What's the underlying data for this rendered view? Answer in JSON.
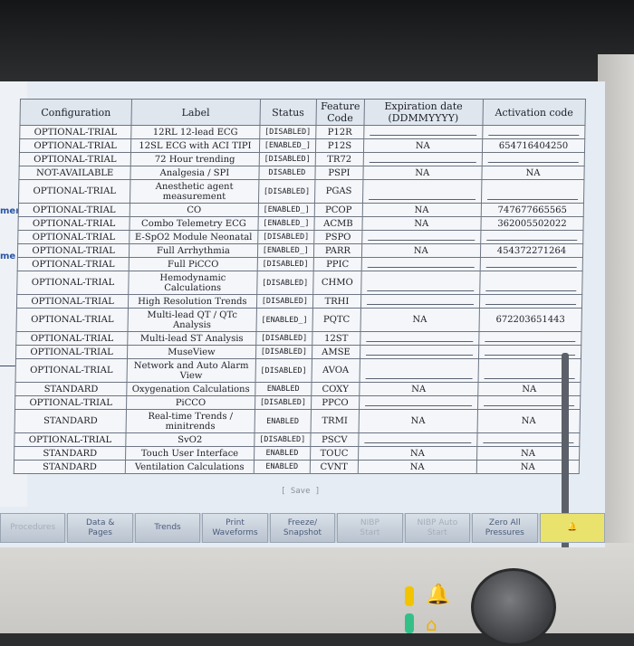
{
  "left_panel": {
    "frag1": "ment",
    "frag2": "me"
  },
  "table": {
    "headers": {
      "configuration": "Configuration",
      "label": "Label",
      "status": "Status",
      "feature_code": "Feature Code",
      "expiration_date": "Expiration date (DDMMYYYY)",
      "activation_code": "Activation code"
    },
    "rows": [
      {
        "config": "OPTIONAL-TRIAL",
        "label": "12RL 12-lead ECG",
        "status": "[DISABLED]",
        "code": "P12R",
        "exp": "",
        "act": ""
      },
      {
        "config": "OPTIONAL-TRIAL",
        "label": "12SL ECG with ACI TIPI",
        "status": "[ENABLED_]",
        "code": "P12S",
        "exp": "NA",
        "act": "654716404250"
      },
      {
        "config": "OPTIONAL-TRIAL",
        "label": "72 Hour trending",
        "status": "[DISABLED]",
        "code": "TR72",
        "exp": "",
        "act": ""
      },
      {
        "config": "NOT-AVAILABLE",
        "label": "Analgesia / SPI",
        "status": "DISABLED",
        "code": "PSPI",
        "exp": "NA",
        "act": "NA"
      },
      {
        "config": "OPTIONAL-TRIAL",
        "label": "Anesthetic agent measurement",
        "status": "[DISABLED]",
        "code": "PGAS",
        "exp": "",
        "act": ""
      },
      {
        "config": "OPTIONAL-TRIAL",
        "label": "CO",
        "status": "[ENABLED_]",
        "code": "PCOP",
        "exp": "NA",
        "act": "747677665565"
      },
      {
        "config": "OPTIONAL-TRIAL",
        "label": "Combo Telemetry ECG",
        "status": "[ENABLED_]",
        "code": "ACMB",
        "exp": "NA",
        "act": "362005502022"
      },
      {
        "config": "OPTIONAL-TRIAL",
        "label": "E-SpO2 Module Neonatal",
        "status": "[DISABLED]",
        "code": "PSPO",
        "exp": "",
        "act": ""
      },
      {
        "config": "OPTIONAL-TRIAL",
        "label": "Full Arrhythmia",
        "status": "[ENABLED_]",
        "code": "PARR",
        "exp": "NA",
        "act": "454372271264"
      },
      {
        "config": "OPTIONAL-TRIAL",
        "label": "Full PiCCO",
        "status": "[DISABLED]",
        "code": "PPIC",
        "exp": "",
        "act": ""
      },
      {
        "config": "OPTIONAL-TRIAL",
        "label": "Hemodynamic Calculations",
        "status": "[DISABLED]",
        "code": "CHMO",
        "exp": "",
        "act": ""
      },
      {
        "config": "OPTIONAL-TRIAL",
        "label": "High Resolution Trends",
        "status": "[DISABLED]",
        "code": "TRHI",
        "exp": "",
        "act": ""
      },
      {
        "config": "OPTIONAL-TRIAL",
        "label": "Multi-lead QT / QTc Analysis",
        "status": "[ENABLED_]",
        "code": "PQTC",
        "exp": "NA",
        "act": "672203651443"
      },
      {
        "config": "OPTIONAL-TRIAL",
        "label": "Multi-lead ST Analysis",
        "status": "[DISABLED]",
        "code": "12ST",
        "exp": "",
        "act": ""
      },
      {
        "config": "OPTIONAL-TRIAL",
        "label": "MuseView",
        "status": "[DISABLED]",
        "code": "AMSE",
        "exp": "",
        "act": ""
      },
      {
        "config": "OPTIONAL-TRIAL",
        "label": "Network and Auto Alarm View",
        "status": "[DISABLED]",
        "code": "AVOA",
        "exp": "",
        "act": ""
      },
      {
        "config": "STANDARD",
        "label": "Oxygenation Calculations",
        "status": "ENABLED",
        "code": "COXY",
        "exp": "NA",
        "act": "NA"
      },
      {
        "config": "OPTIONAL-TRIAL",
        "label": "PiCCO",
        "status": "[DISABLED]",
        "code": "PPCO",
        "exp": "",
        "act": ""
      },
      {
        "config": "STANDARD",
        "label": "Real-time Trends / minitrends",
        "status": "ENABLED",
        "code": "TRMI",
        "exp": "NA",
        "act": "NA"
      },
      {
        "config": "OPTIONAL-TRIAL",
        "label": "SvO2",
        "status": "[DISABLED]",
        "code": "PSCV",
        "exp": "",
        "act": ""
      },
      {
        "config": "STANDARD",
        "label": "Touch User Interface",
        "status": "ENABLED",
        "code": "TOUC",
        "exp": "NA",
        "act": "NA"
      },
      {
        "config": "STANDARD",
        "label": "Ventilation Calculations",
        "status": "ENABLED",
        "code": "CVNT",
        "exp": "NA",
        "act": "NA"
      }
    ]
  },
  "save_label": "[ Save ]",
  "toolbar": [
    {
      "label": "Procedures",
      "dim": true
    },
    {
      "label": "Data &\nPages",
      "dim": false
    },
    {
      "label": "Trends",
      "dim": false
    },
    {
      "label": "Print\nWaveforms",
      "dim": false
    },
    {
      "label": "Freeze/\nSnapshot",
      "dim": false
    },
    {
      "label": "NIBP\nStart",
      "dim": true
    },
    {
      "label": "NIBP Auto\nStart",
      "dim": true
    },
    {
      "label": "Zero All\nPressures",
      "dim": false
    },
    {
      "label": "",
      "dim": false,
      "alarm": true
    }
  ],
  "colors": {
    "enabled_yellow": "#e9e36d",
    "led_yellow": "#f2c400",
    "led_green": "#33c088",
    "label_blue": "#2a55a5"
  }
}
